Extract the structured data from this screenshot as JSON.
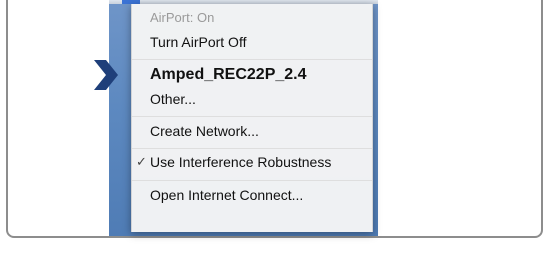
{
  "menu": {
    "status": "AirPort: On",
    "toggle": "Turn AirPort Off",
    "network_selected": "Amped_REC22P_2.4",
    "other": "Other...",
    "create_network": "Create Network...",
    "check_mark": "✓",
    "interference": "Use Interference Robustness",
    "open_connect": "Open Internet Connect..."
  },
  "colors": {
    "arrow": "#1f3f7a",
    "desktop": "#5d89c0",
    "frame_border": "#8d8d8d"
  },
  "icons": {
    "pointer": "chevron-right-icon"
  }
}
